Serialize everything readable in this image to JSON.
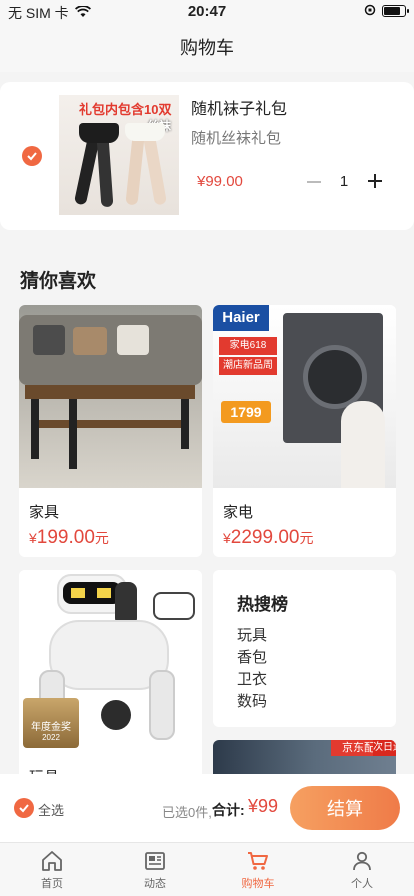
{
  "status_bar": {
    "carrier": "无 SIM 卡",
    "time": "20:47",
    "battery_level": 0.85
  },
  "header": {
    "title": "购物车"
  },
  "cart_item": {
    "title": "随机袜子礼包",
    "subtitle": "随机丝袜礼包",
    "price": "¥99.00",
    "quantity": "1",
    "image_banner": "礼包内包含10双",
    "image_sub": "丝袜",
    "checked": true
  },
  "recommend": {
    "title": "猜你喜欢",
    "items": [
      {
        "name": "家具",
        "yen": "¥",
        "price": "199.00",
        "unit": "元"
      },
      {
        "name": "家电",
        "yen": "¥",
        "price": "2299.00",
        "unit": "元"
      },
      {
        "name": "玩具"
      }
    ],
    "hot": {
      "title": "热搜榜",
      "items": [
        "玩具",
        "香包",
        "卫衣",
        "数码"
      ]
    },
    "washer_brand": "Haier",
    "washer_badges": [
      "家电618",
      "潮店新品周"
    ],
    "washer_price": "1799",
    "jd_banner": [
      "京东配送",
      "次日送达"
    ],
    "toy_badge": "年度金奖",
    "toy_badge_year": "2022"
  },
  "footer": {
    "select_all": "全选",
    "selected_count": "已选0件,",
    "total_label": "合计:",
    "total_amount": "¥99",
    "checkout": "结算"
  },
  "tabs": [
    {
      "label": "首页",
      "icon": "home-icon"
    },
    {
      "label": "动态",
      "icon": "news-icon"
    },
    {
      "label": "购物车",
      "icon": "cart-icon",
      "active": true
    },
    {
      "label": "个人",
      "icon": "person-icon"
    }
  ],
  "colors": {
    "accent": "#f06842",
    "price": "#e2483d"
  }
}
